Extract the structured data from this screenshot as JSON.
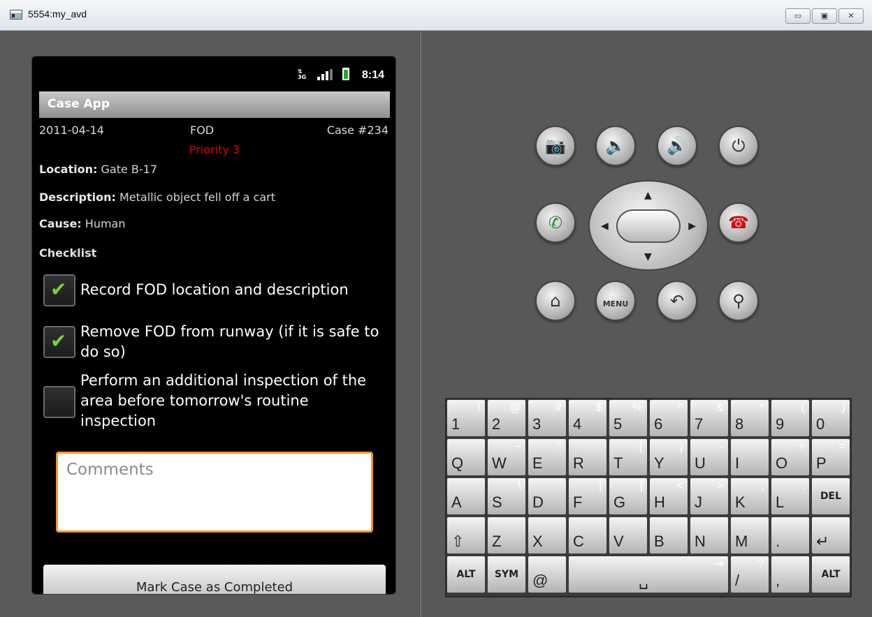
{
  "window": {
    "title": "5554:my_avd",
    "min_label": "▭",
    "max_label": "▣",
    "close_label": "✕"
  },
  "statusbar": {
    "time": "8:14",
    "network": "3G"
  },
  "app": {
    "title": "Case App"
  },
  "case": {
    "date": "2011-04-14",
    "type": "FOD",
    "number": "Case #234",
    "priority": "Priority 3",
    "location_label": "Location:",
    "location": "Gate B-17",
    "description_label": "Description:",
    "description": "Metallic object fell off a cart",
    "cause_label": "Cause:",
    "cause": "Human"
  },
  "checklist": {
    "heading": "Checklist",
    "items": [
      {
        "label": "Record FOD location and description",
        "checked": true
      },
      {
        "label": "Remove FOD from runway (if it is safe to do so)",
        "checked": true
      },
      {
        "label": "Perform an additional inspection of the area before tomorrow's routine inspection",
        "checked": false
      }
    ]
  },
  "comments": {
    "placeholder": "Comments",
    "value": ""
  },
  "actions": {
    "complete_label": "Mark Case as Completed"
  },
  "hardware": {
    "menu_label": "MENU",
    "buttons": [
      "camera-icon",
      "volume-down-icon",
      "volume-up-icon",
      "power-icon",
      "call-icon",
      "end-call-icon",
      "home-icon",
      "back-icon",
      "search-icon"
    ]
  },
  "keyboard": {
    "rows": [
      [
        [
          "1",
          "!"
        ],
        [
          "2",
          "@"
        ],
        [
          "3",
          "#"
        ],
        [
          "4",
          "$"
        ],
        [
          "5",
          "%"
        ],
        [
          "6",
          "^"
        ],
        [
          "7",
          "&"
        ],
        [
          "8",
          "*"
        ],
        [
          "9",
          "("
        ],
        [
          "0",
          ")"
        ]
      ],
      [
        [
          "Q",
          ""
        ],
        [
          "W",
          "~"
        ],
        [
          "E",
          "\""
        ],
        [
          "R",
          "`"
        ],
        [
          "T",
          "{"
        ],
        [
          "Y",
          "}"
        ],
        [
          "U",
          "-"
        ],
        [
          "I",
          ""
        ],
        [
          "O",
          "+"
        ],
        [
          "P",
          "="
        ]
      ],
      [
        [
          "A",
          ""
        ],
        [
          "S",
          "\\"
        ],
        [
          "D",
          "'"
        ],
        [
          "F",
          "["
        ],
        [
          "G",
          "]"
        ],
        [
          "H",
          "<"
        ],
        [
          "J",
          ">"
        ],
        [
          "K",
          ";"
        ],
        [
          "L",
          ":"
        ]
      ],
      [
        [
          "Z",
          ""
        ],
        [
          "X",
          ""
        ],
        [
          "C",
          ""
        ],
        [
          "V",
          ""
        ],
        [
          "B",
          ""
        ],
        [
          "N",
          ""
        ],
        [
          "M",
          ""
        ],
        [
          ".",
          ""
        ]
      ]
    ],
    "del_label": "DEL",
    "alt_label": "ALT",
    "sym_label": "SYM",
    "at_label": "@",
    "slash_label": "/",
    "slash_alt": "?",
    "comma_label": ","
  }
}
